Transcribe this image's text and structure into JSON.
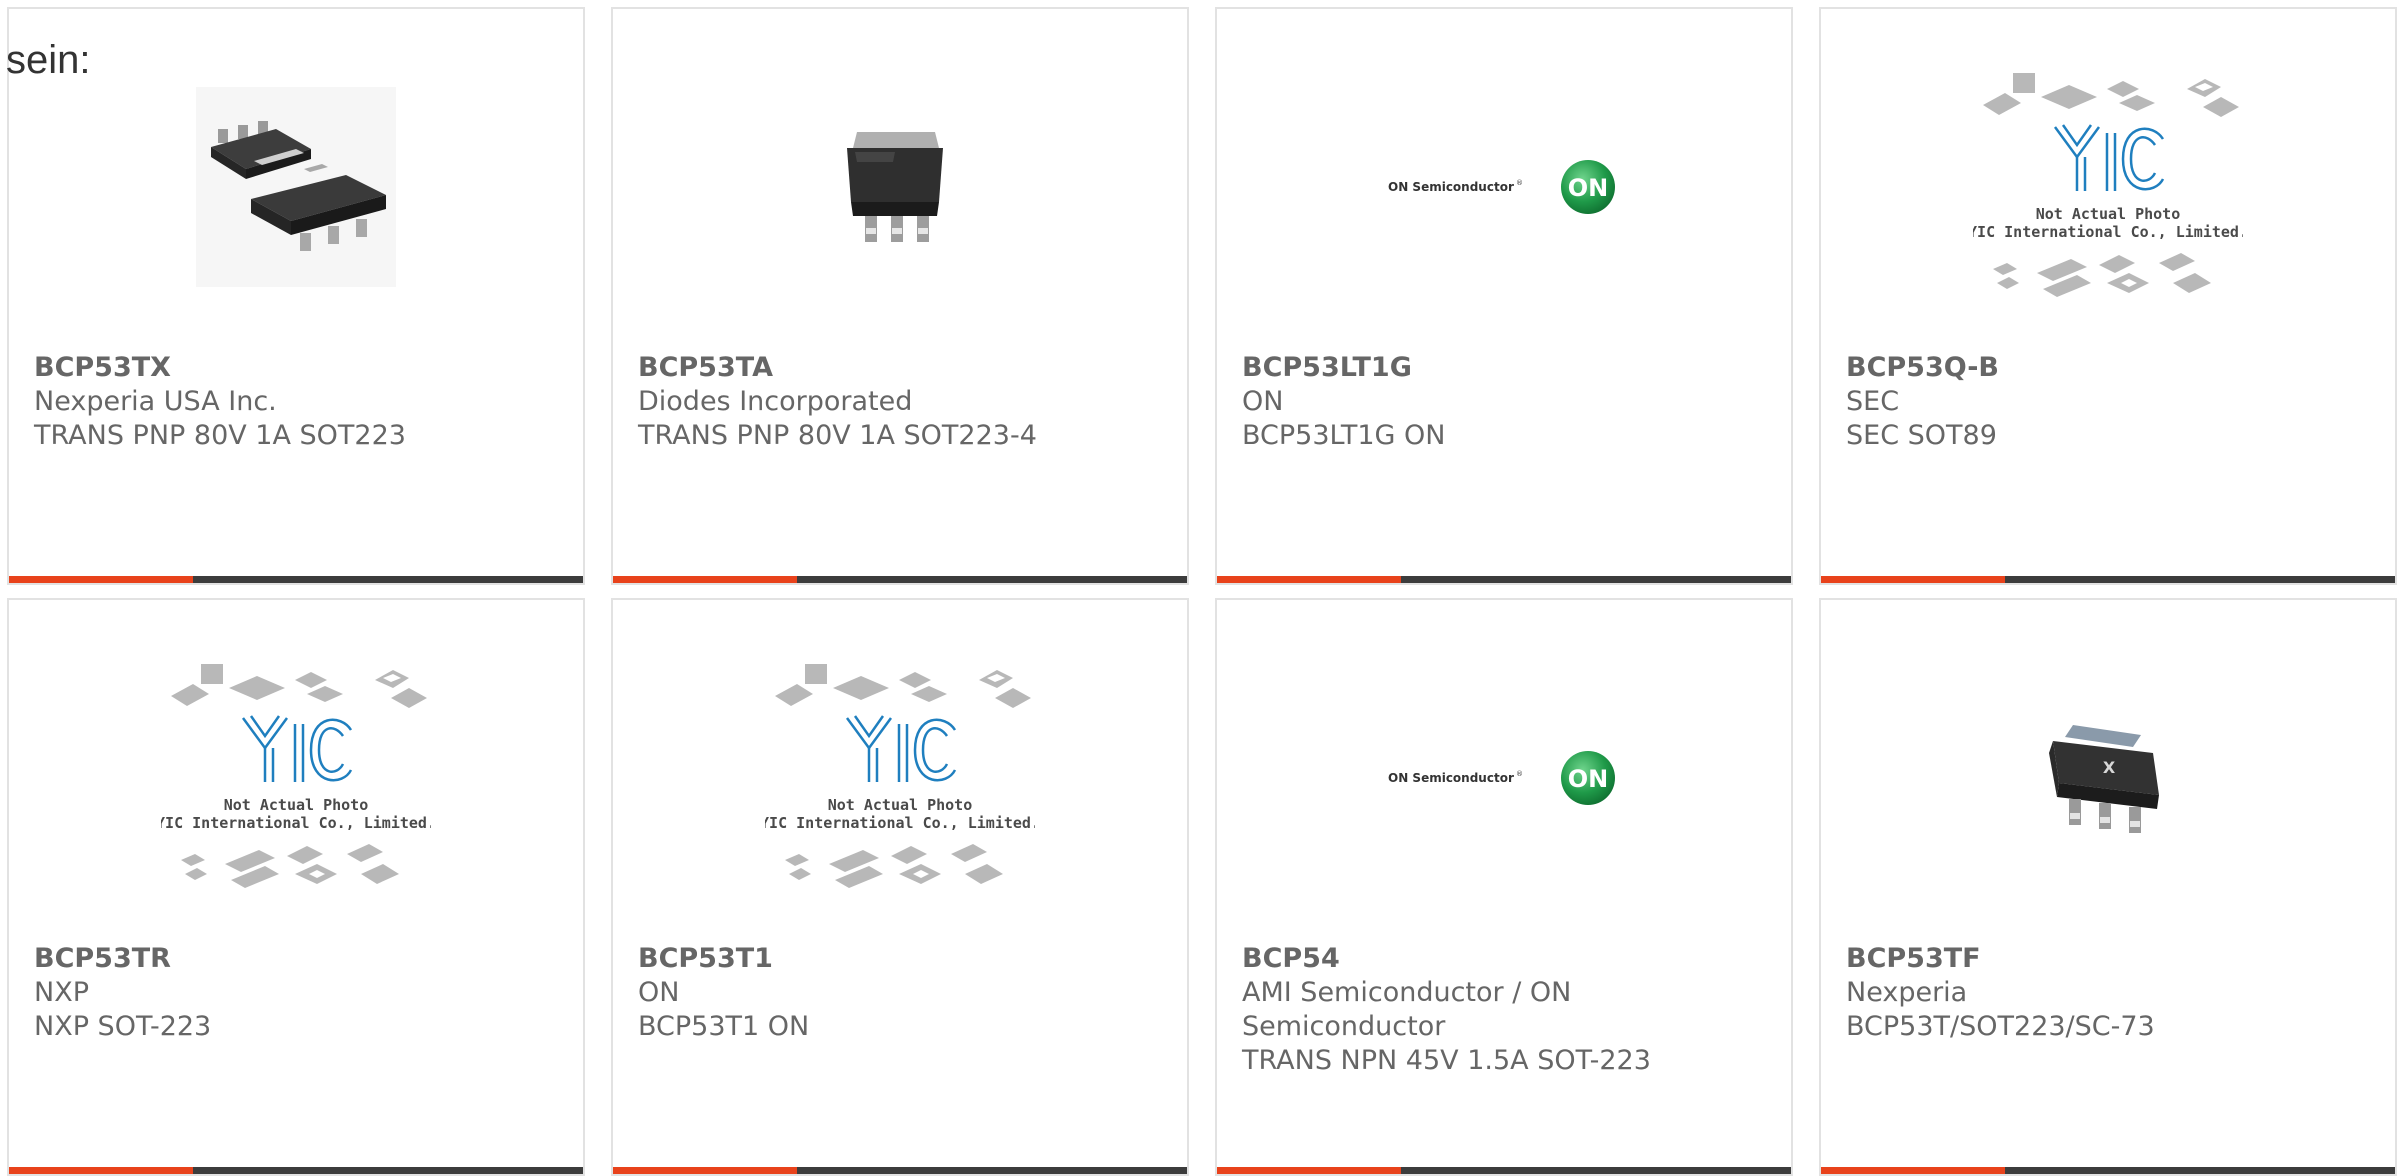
{
  "page": {
    "lead_text": "sein:"
  },
  "colors": {
    "accent": "#e8421b",
    "bar": "#3c3c3c",
    "text": "#666666",
    "border": "#e2e2e2"
  },
  "products": [
    {
      "part": "BCP53TX",
      "manufacturer": "Nexperia USA Inc.",
      "description": "TRANS PNP 80V 1A SOT223",
      "image": "sot223-pair-photo"
    },
    {
      "part": "BCP53TA",
      "manufacturer": "Diodes Incorporated",
      "description": "TRANS PNP 80V 1A SOT223-4",
      "image": "sot223-photo"
    },
    {
      "part": "BCP53LT1G",
      "manufacturer": "ON",
      "description": "BCP53LT1G ON",
      "image": "on-semiconductor-logo"
    },
    {
      "part": "BCP53Q-B",
      "manufacturer": "SEC",
      "description": "SEC SOT89",
      "image": "yic-placeholder"
    },
    {
      "part": "BCP53TR",
      "manufacturer": "NXP",
      "description": "NXP SOT-223",
      "image": "yic-placeholder"
    },
    {
      "part": "BCP53T1",
      "manufacturer": "ON",
      "description": "BCP53T1 ON",
      "image": "yic-placeholder"
    },
    {
      "part": "BCP54",
      "manufacturer": "AMI Semiconductor / ON Semiconductor",
      "description": "TRANS NPN 45V 1.5A SOT-223",
      "image": "on-semiconductor-logo"
    },
    {
      "part": "BCP53TF",
      "manufacturer": "Nexperia",
      "description": "BCP53T/SOT223/SC-73",
      "image": "nexperia-sot223-photo"
    }
  ],
  "on_logo": {
    "brand": "ON Semiconductor",
    "mark": "ON",
    "reg": "®"
  },
  "yic_placeholder": {
    "mark": "YIC",
    "line1": "Not Actual Photo",
    "line2": "YIC International Co., Limited."
  },
  "chip_marking": "X"
}
